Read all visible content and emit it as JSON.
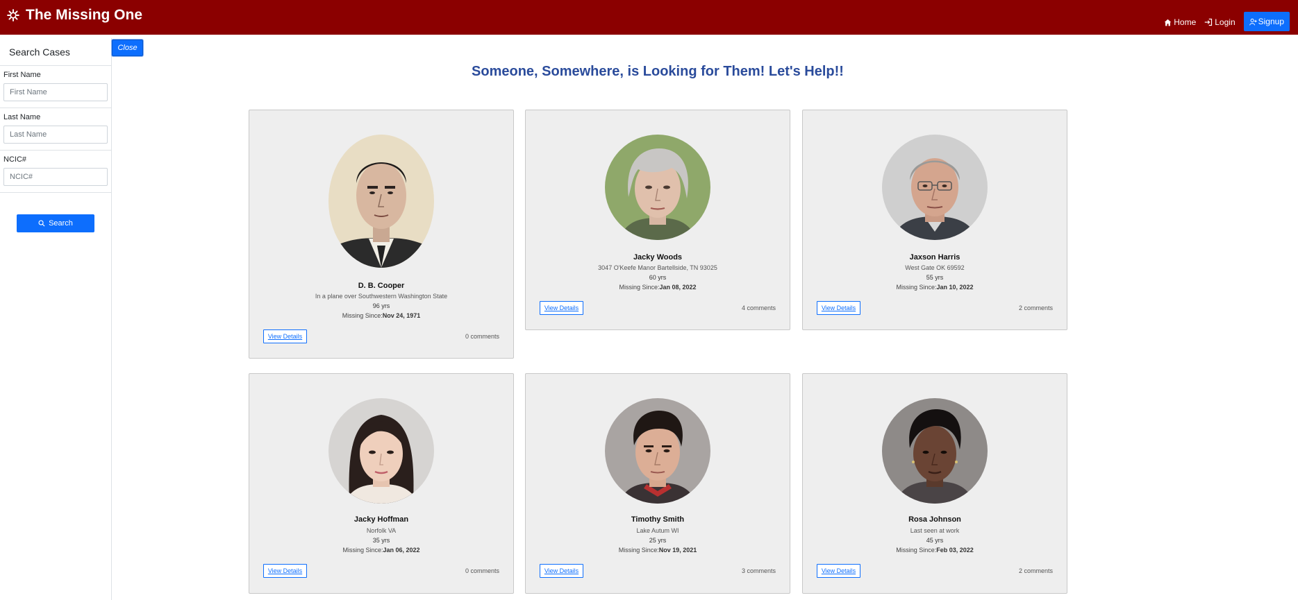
{
  "app": {
    "title": "The Missing One"
  },
  "nav": {
    "home": "Home",
    "login": "Login",
    "signup": "Signup"
  },
  "sidebar": {
    "header": "Search Cases",
    "close_label": "Close",
    "fields": [
      {
        "label": "First Name",
        "placeholder": "First Name"
      },
      {
        "label": "Last Name",
        "placeholder": "Last Name"
      },
      {
        "label": "NCIC#",
        "placeholder": "NCIC#"
      }
    ],
    "search_label": "Search"
  },
  "main": {
    "headline": "Someone, Somewhere, is Looking for Them! Let's Help!!"
  },
  "cards": [
    {
      "name": "D. B. Cooper",
      "location": "In a plane over Southwestern Washington State",
      "age": "96 yrs",
      "since_label": "Missing Since:",
      "since_date": "Nov 24, 1971",
      "button": "View Details",
      "comments": "0 comments"
    },
    {
      "name": "Jacky Woods",
      "location": "3047 O'Keefe Manor Bartellside, TN 93025",
      "age": "60 yrs",
      "since_label": "Missing Since:",
      "since_date": "Jan 08, 2022",
      "button": "View Details",
      "comments": "4 comments"
    },
    {
      "name": "Jaxson Harris",
      "location": "West Gate OK 69592",
      "age": "55 yrs",
      "since_label": "Missing Since:",
      "since_date": "Jan 10, 2022",
      "button": "View Details",
      "comments": "2 comments"
    },
    {
      "name": "Jacky Hoffman",
      "location": "Norfolk VA",
      "age": "35 yrs",
      "since_label": "Missing Since:",
      "since_date": "Jan 06, 2022",
      "button": "View Details",
      "comments": "0 comments"
    },
    {
      "name": "Timothy Smith",
      "location": "Lake Autum WI",
      "age": "25 yrs",
      "since_label": "Missing Since:",
      "since_date": "Nov 19, 2021",
      "button": "View Details",
      "comments": "3 comments"
    },
    {
      "name": "Rosa Johnson",
      "location": "Last seen at work",
      "age": "45 yrs",
      "since_label": "Missing Since:",
      "since_date": "Feb 03, 2022",
      "button": "View Details",
      "comments": "2 comments"
    }
  ],
  "colors": {
    "navbar": "#8b0000",
    "accent": "#0d6efd",
    "headline": "#2a4b9b",
    "card_bg": "#eeeeee"
  },
  "icons": {
    "brand": "gear-icon",
    "home": "home-icon",
    "login": "login-icon",
    "signup": "user-plus-icon",
    "search": "search-icon"
  }
}
